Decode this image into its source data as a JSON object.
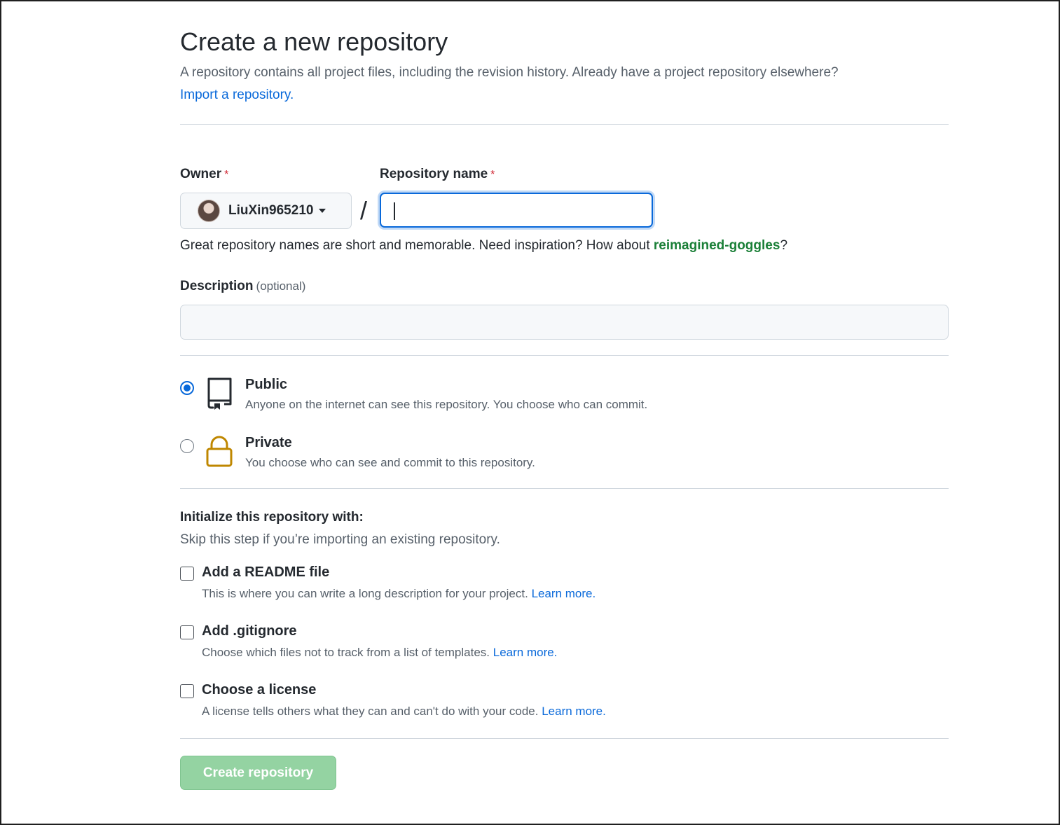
{
  "header": {
    "title": "Create a new repository",
    "subtitle": "A repository contains all project files, including the revision history. Already have a project repository elsewhere?",
    "import_link": "Import a repository."
  },
  "owner": {
    "label": "Owner",
    "required_mark": "*",
    "value": "LiuXin965210"
  },
  "repo_name": {
    "label": "Repository name",
    "required_mark": "*",
    "value": "",
    "separator": "/"
  },
  "hint": {
    "text": "Great repository names are short and memorable. Need inspiration? How about ",
    "suggestion": "reimagined-goggles",
    "end": "?"
  },
  "description": {
    "label": "Description",
    "optional": "(optional)",
    "value": ""
  },
  "visibility": {
    "selected": "public",
    "public": {
      "title": "Public",
      "desc": "Anyone on the internet can see this repository. You choose who can commit.",
      "icon": "repo-icon"
    },
    "private": {
      "title": "Private",
      "desc": "You choose who can see and commit to this repository.",
      "icon": "lock-icon"
    }
  },
  "init": {
    "title": "Initialize this repository with:",
    "subtitle": "Skip this step if you’re importing an existing repository.",
    "readme": {
      "label": "Add a README file",
      "desc": "This is where you can write a long description for your project.",
      "link": "Learn more.",
      "checked": false
    },
    "gitignore": {
      "label": "Add .gitignore",
      "desc": "Choose which files not to track from a list of templates.",
      "link": "Learn more.",
      "checked": false
    },
    "license": {
      "label": "Choose a license",
      "desc": "A license tells others what they can and can't do with your code.",
      "link": "Learn more.",
      "checked": false
    }
  },
  "submit": {
    "label": "Create repository",
    "disabled": true
  },
  "colors": {
    "link": "#0969da",
    "suggestion": "#1a7f37",
    "required": "#cf222e",
    "button_disabled": "#94d3a2",
    "lock_icon": "#bf8700"
  }
}
